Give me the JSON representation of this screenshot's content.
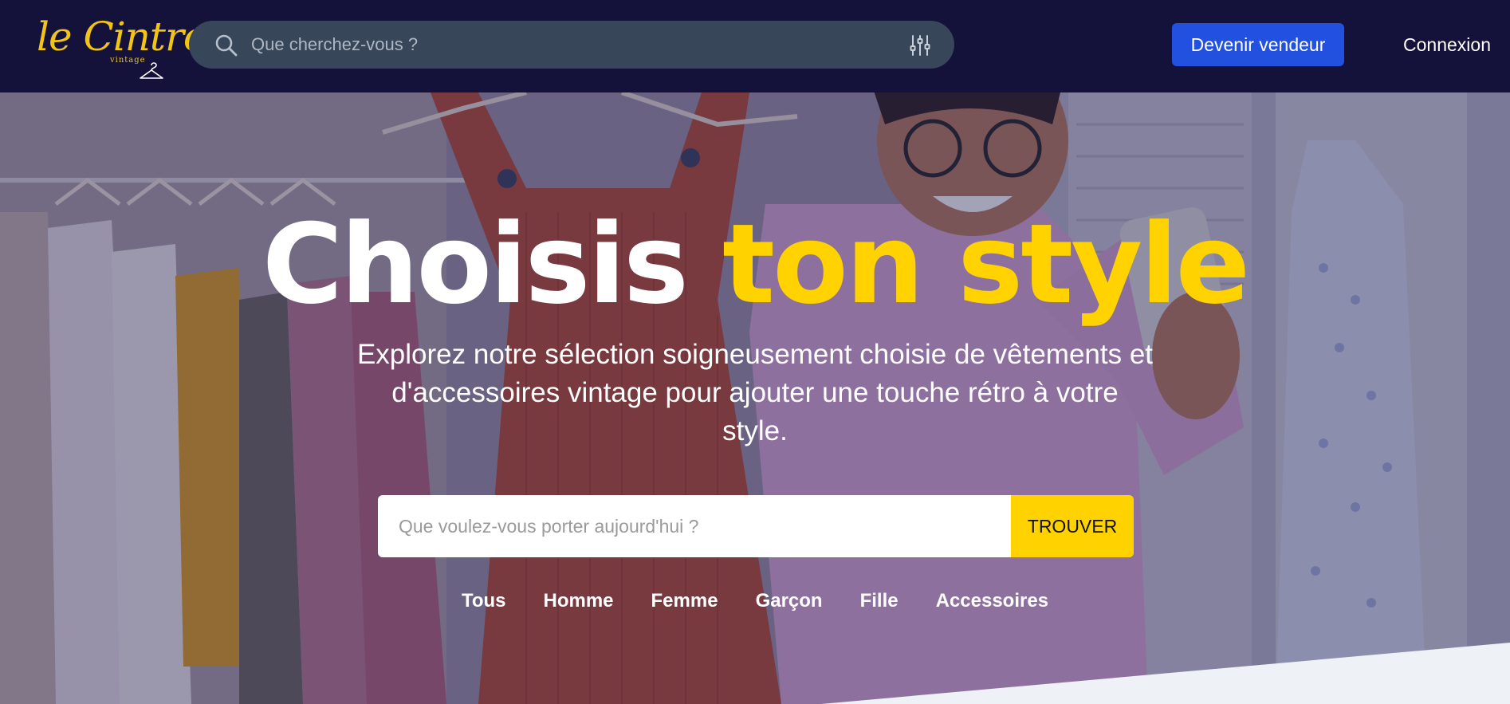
{
  "brand": {
    "name": "le Cintre",
    "tagline": "vintage"
  },
  "header": {
    "search_placeholder": "Que cherchez-vous ?",
    "become_seller_label": "Devenir vendeur",
    "login_label": "Connexion"
  },
  "hero": {
    "title_part1": "Choisis",
    "title_part2": "ton style",
    "subtitle": "Explorez notre sélection soigneusement choisie de vêtements et d'accessoires vintage pour ajouter une touche rétro à votre style.",
    "search_placeholder": "Que voulez-vous porter aujourd'hui ?",
    "find_button_label": "TROUVER",
    "categories": [
      "Tous",
      "Homme",
      "Femme",
      "Garçon",
      "Fille",
      "Accessoires"
    ]
  },
  "colors": {
    "header_bg": "#14123a",
    "brand_yellow": "#f2c416",
    "accent_yellow": "#ffd200",
    "primary_blue": "#2251e0",
    "search_bg": "#384659"
  },
  "icons": {
    "search": "search-icon",
    "filter": "filter-sliders-icon",
    "hanger": "hanger-icon"
  }
}
